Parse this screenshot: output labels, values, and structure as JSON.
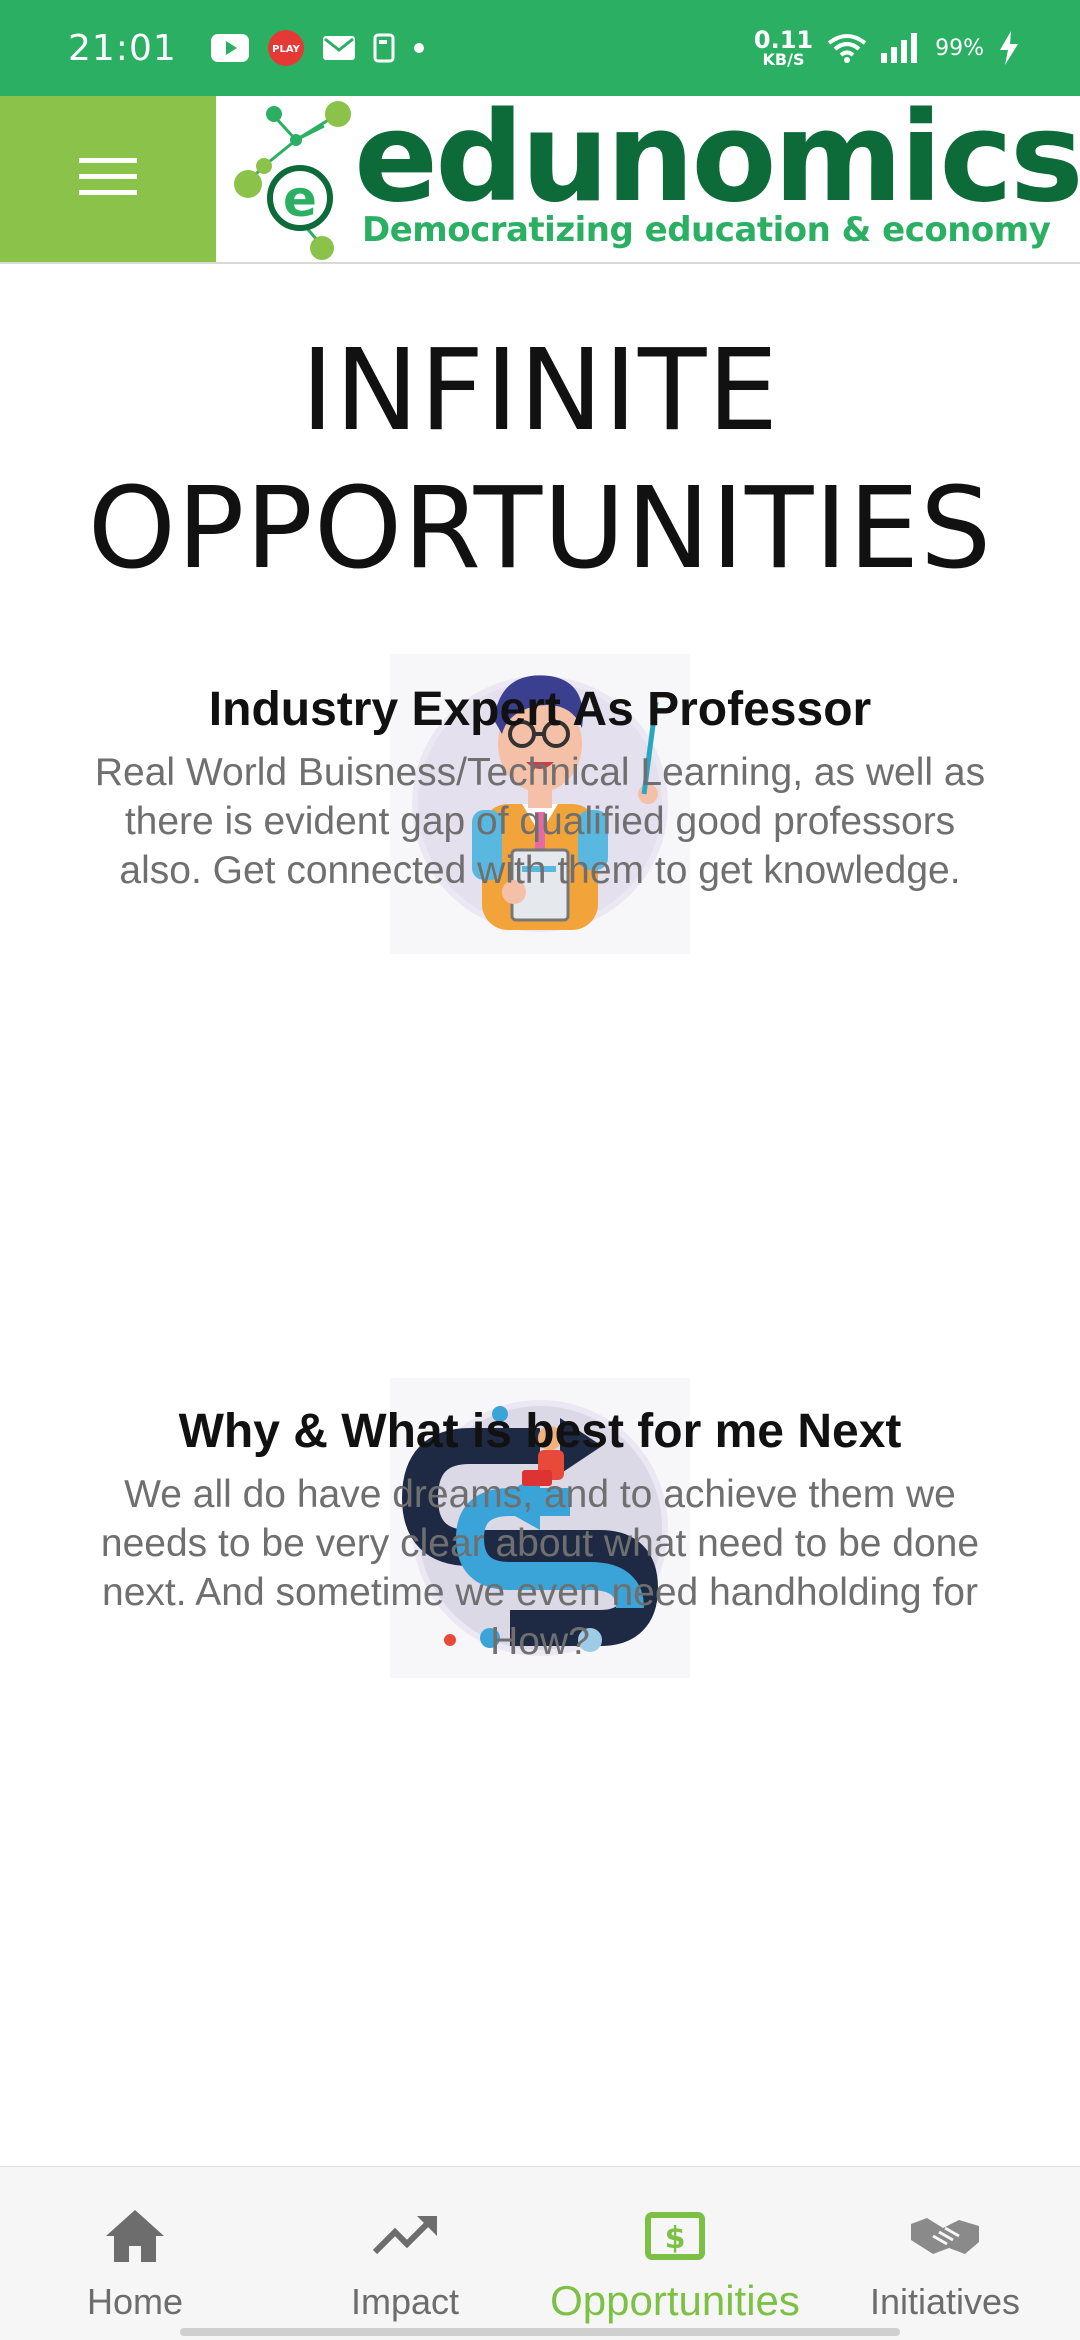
{
  "status_bar": {
    "time": "21:01",
    "net_speed_value": "0.11",
    "net_speed_unit": "KB/S",
    "battery": "99%",
    "icons": [
      "youtube-icon",
      "play-store-icon",
      "mail-icon",
      "screenshot-icon",
      "dot-icon",
      "wifi-icon",
      "signal-icon",
      "charging-icon"
    ],
    "play_badge_text": "PLAY"
  },
  "header": {
    "brand": "edunomics",
    "tagline": "Democratizing education & economy",
    "menu_icon": "hamburger-menu-icon"
  },
  "main": {
    "title_line1": "INFINITE",
    "title_line2": "OPPORTUNITIES",
    "features": [
      {
        "heading": "Industry Expert As Professor",
        "description": "Real World Buisness/Technical Learning, as well as there is evident gap of qualified good professors also. Get connected with them to get knowledge.",
        "image": "professor-illustration"
      },
      {
        "heading": "Why & What is best for me Next",
        "description": "We all do have dreams, and to achieve them we needs to be very clear about what need to be done next. And sometime we even need handholding for How?",
        "image": "direction-arrows-illustration"
      }
    ]
  },
  "bottom_nav": {
    "active": "Opportunities",
    "items": [
      {
        "label": "Home",
        "icon": "home-icon"
      },
      {
        "label": "Impact",
        "icon": "trending-up-icon"
      },
      {
        "label": "Opportunities",
        "icon": "dollar-icon"
      },
      {
        "label": "Initiatives",
        "icon": "handshake-icon"
      }
    ]
  },
  "colors": {
    "status_bar": "#2bb063",
    "menu_button": "#8bc34a",
    "brand_dark": "#0d6b3a",
    "brand_light": "#2bb063",
    "nav_active": "#7cc146",
    "nav_inactive": "#6d6d6d"
  }
}
